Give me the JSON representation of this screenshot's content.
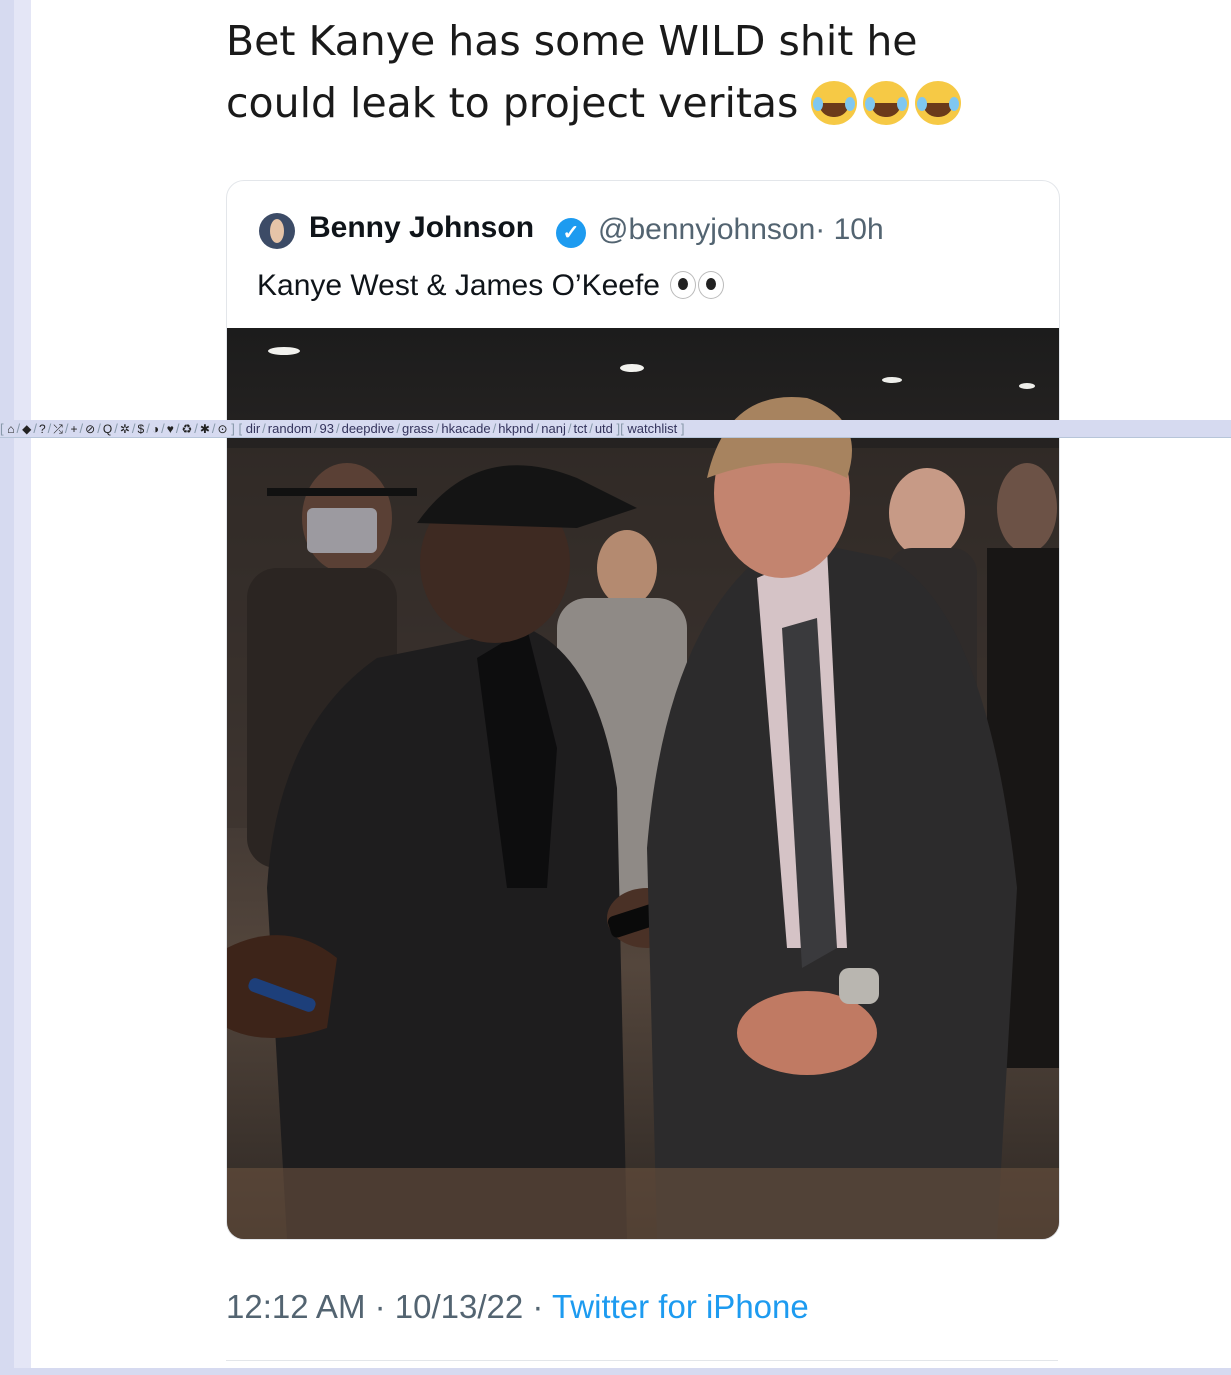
{
  "headline": {
    "line1": "Bet Kanye has some WILD shit he",
    "line2": "could leak to project veritas"
  },
  "tweet": {
    "author_name": "Benny Johnson",
    "handle": "@bennyjohnson",
    "age": "· 10h",
    "text": "Kanye West & James O’Keefe"
  },
  "footer": {
    "time": "12:12 AM · 10/13/22 ·",
    "source": "Twitter for iPhone"
  },
  "navbar": {
    "icons": [
      "home-icon",
      "tag-icon",
      "help-icon",
      "shuffle-icon",
      "plus-icon",
      "block-icon",
      "search-icon",
      "gear-icon",
      "dollar-icon",
      "theme-icon",
      "twitter-icon",
      "recycle-icon",
      "bug-icon",
      "check-icon"
    ],
    "glyphs": {
      "home": "⌂",
      "tag": "◆",
      "help": "?",
      "shuffle": "⤮",
      "plus": "+",
      "block": "⊘",
      "search": "Q",
      "gear": "✲",
      "dollar": "$",
      "theme": "◑",
      "twitter": "♥",
      "recycle": "♻",
      "bug": "✱",
      "check": "⊙"
    },
    "links": [
      "dir",
      "random",
      "93",
      "deepdive",
      "grass",
      "hkacade",
      "hkpnd",
      "nanj",
      "tct",
      "utd"
    ],
    "watchlist": "watchlist",
    "open_bracket": "[",
    "close_bracket": "]",
    "separator": "/"
  },
  "colors": {
    "page_background": "#ffffff",
    "side_strip": "#d6daf0",
    "link_blue": "#1d9bf0",
    "verified_blue": "#1d9bf0",
    "muted_text": "#536471"
  }
}
